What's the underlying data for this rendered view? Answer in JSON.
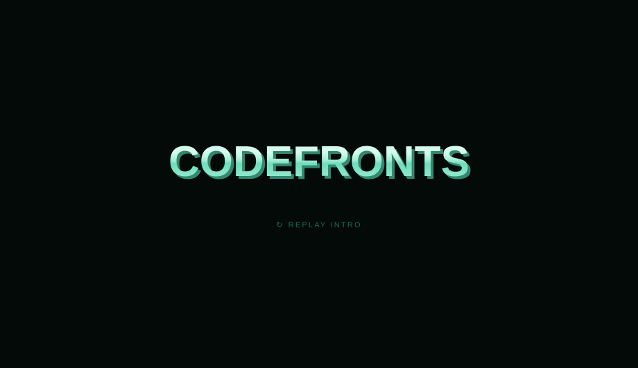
{
  "logo": {
    "text": "CODEFRONTS"
  },
  "replay": {
    "icon": "↻",
    "label": "REPLAY INTRO"
  },
  "colors": {
    "background": "#030a08",
    "logo_light": "#c9f8e6",
    "logo_mid": "#6fdcbc",
    "logo_shadow": "#2f8a6e",
    "replay_text": "#1d6b55"
  }
}
